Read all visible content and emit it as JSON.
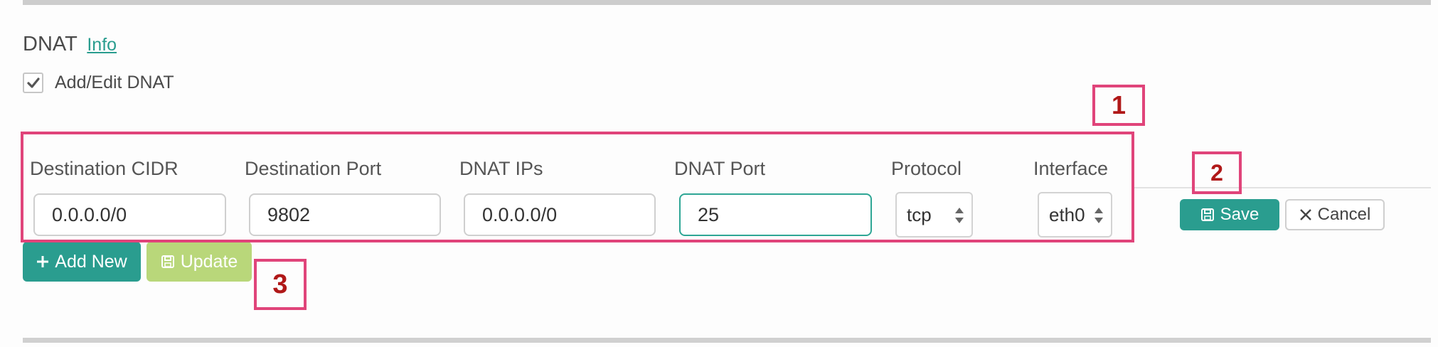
{
  "section": {
    "title": "DNAT",
    "info_link": "Info"
  },
  "checkbox": {
    "label": "Add/Edit DNAT",
    "checked": true
  },
  "columns": [
    "Destination CIDR",
    "Destination Port",
    "DNAT IPs",
    "DNAT Port",
    "Protocol",
    "Interface"
  ],
  "row": {
    "destination_cidr": "0.0.0.0/0",
    "destination_port": "9802",
    "dnat_ips": "0.0.0.0/0",
    "dnat_port": "25",
    "protocol": "tcp",
    "interface": "eth0"
  },
  "buttons": {
    "save": "Save",
    "cancel": "Cancel",
    "add_new": "Add New",
    "update": "Update"
  },
  "annotations": [
    "1",
    "2",
    "3"
  ],
  "colors": {
    "accent": "#2a9d8f",
    "annotation_border": "#e0447a",
    "annotation_text": "#b01818",
    "update_green": "#b9d77a"
  }
}
